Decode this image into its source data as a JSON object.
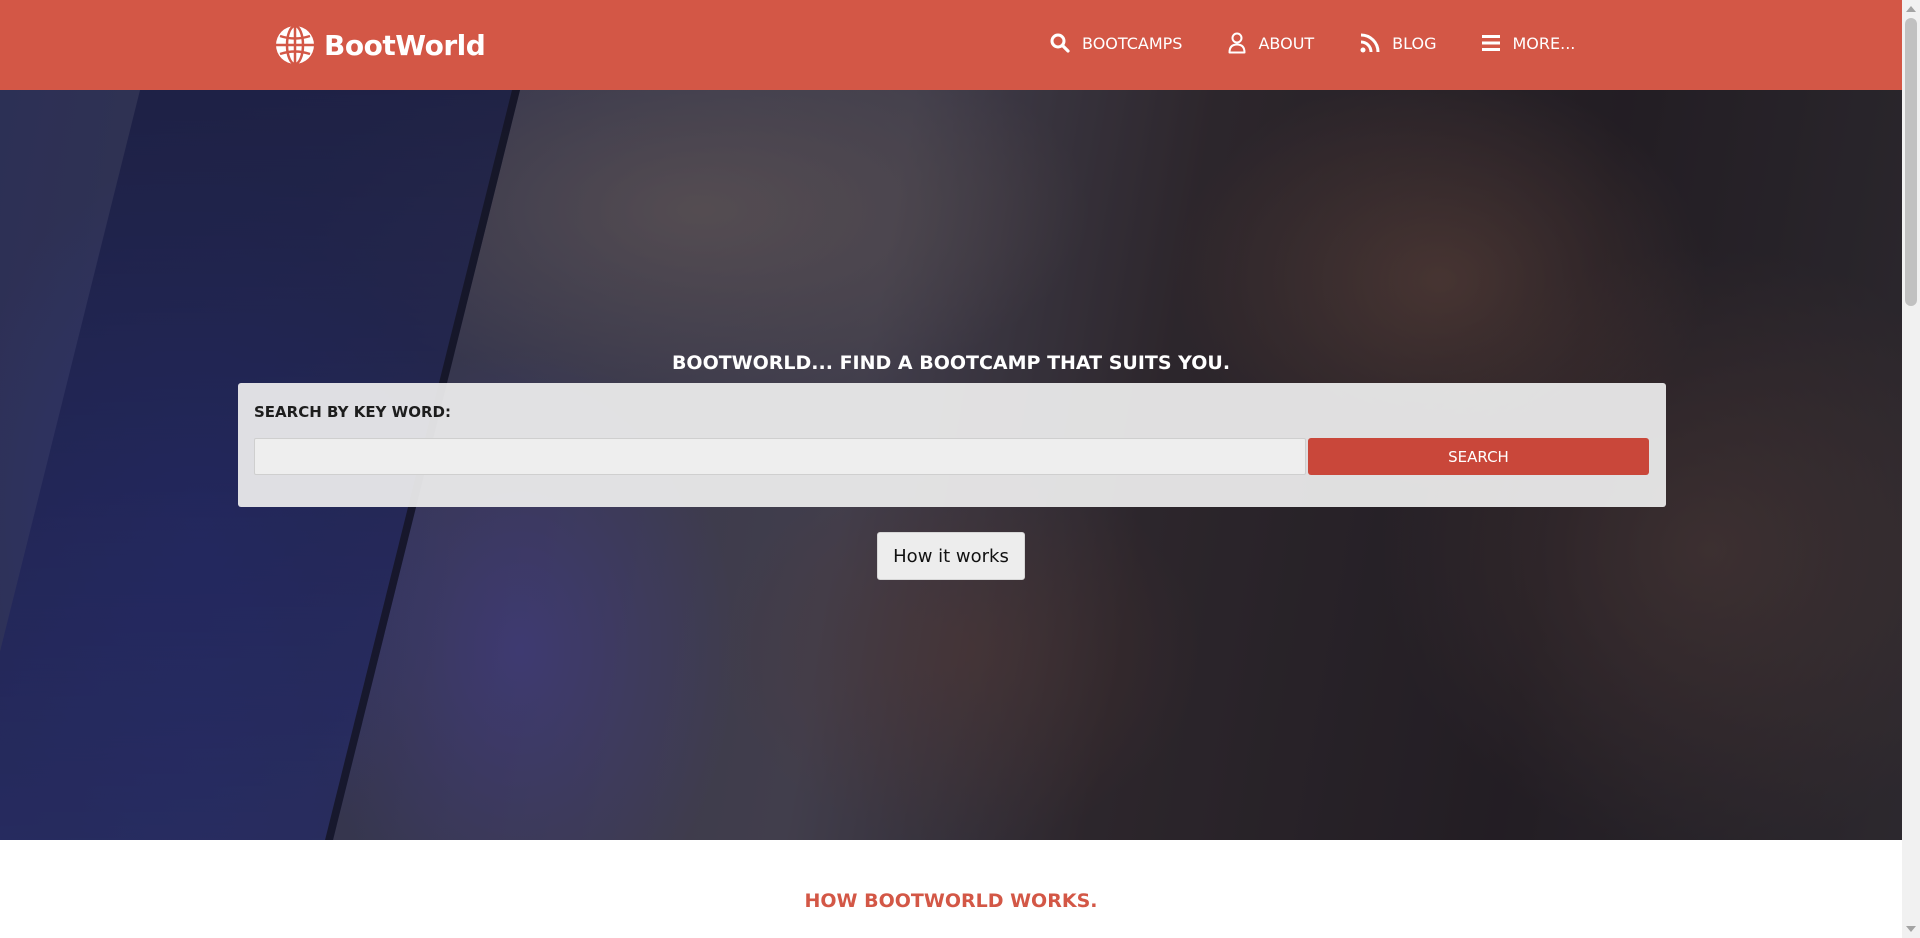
{
  "header": {
    "brand": "BootWorld",
    "brand_color": "#d35746",
    "logo_icon": "globe-icon",
    "nav": [
      {
        "label": "BOOTCAMPS",
        "icon": "search-icon"
      },
      {
        "label": "ABOUT",
        "icon": "user-icon"
      },
      {
        "label": "BLOG",
        "icon": "rss-icon"
      },
      {
        "label": "MORE...",
        "icon": "menu-icon"
      }
    ]
  },
  "hero": {
    "title": "BOOTWORLD... FIND A BOOTCAMP THAT SUITS YOU.",
    "search_label": "SEARCH BY KEY WORD:",
    "search_value": "",
    "search_button": "SEARCH",
    "how_button": "How it works"
  },
  "section": {
    "title": "HOW BOOTWORLD WORKS."
  }
}
